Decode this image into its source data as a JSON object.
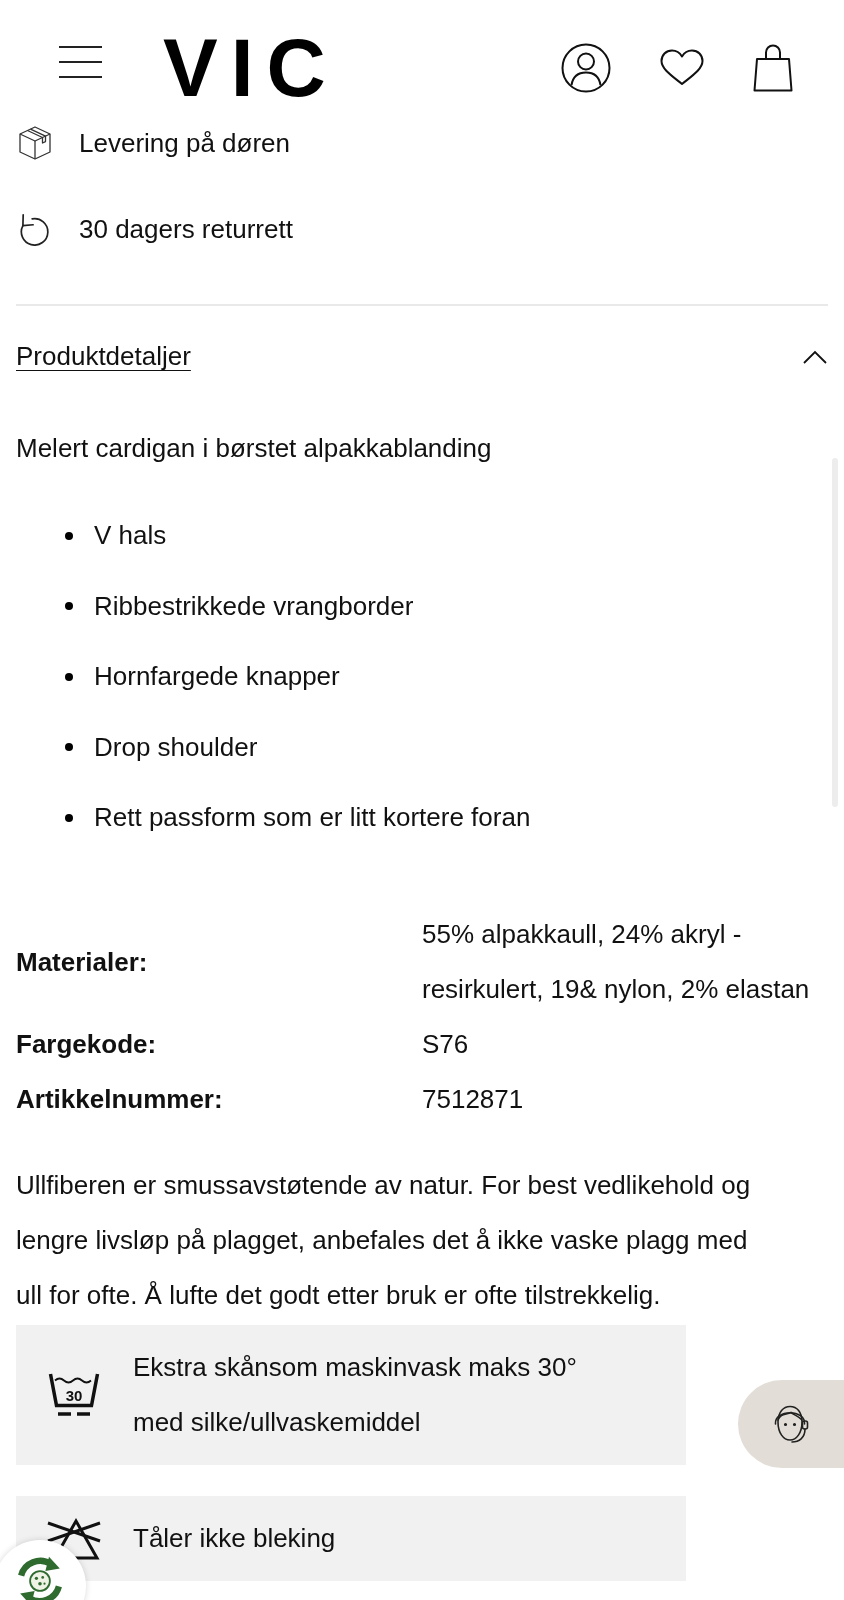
{
  "header": {
    "logo": "VIC"
  },
  "perks": [
    {
      "kind": "delivery",
      "label": "Levering på døren"
    },
    {
      "kind": "returns",
      "label": "30 dagers returrett"
    }
  ],
  "product_details": {
    "title": "Produktdetaljer",
    "expanded": true,
    "description": "Melert cardigan i børstet alpakkablanding",
    "features": [
      "V hals",
      "Ribbestrikkede vrangborder",
      "Hornfargede knapper",
      "Drop shoulder",
      "Rett passform som er litt kortere foran"
    ],
    "specs": [
      {
        "label": "Materialer:",
        "value": "55% alpakkaull, 24% akryl - resirkulert, 19& nylon, 2% elastan"
      },
      {
        "label": "Fargekode:",
        "value": "S76"
      },
      {
        "label": "Artikkelnummer:",
        "value": "7512871"
      }
    ],
    "care_note": "Ullfiberen er smussavstøtende av natur. For best vedlikehold og lengre livsløp på plagget, anbefales det å ikke vaske plagg med ull for ofte. Å lufte det godt etter bruk er ofte tilstrekkelig.",
    "care_instructions": [
      {
        "kind": "wash",
        "temperature": "30",
        "label": "Ekstra skånsom maskinvask maks 30° med silke/ullvaskemiddel"
      },
      {
        "kind": "no_bleach",
        "label": "Tåler ikke bleking"
      }
    ]
  }
}
